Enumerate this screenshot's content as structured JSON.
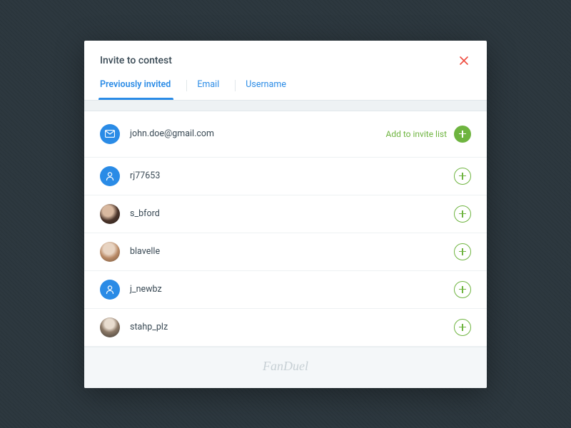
{
  "modal": {
    "title": "Invite to contest",
    "tabs": [
      "Previously invited",
      "Email",
      "Username"
    ],
    "activeTab": 0,
    "addLabel": "Add to invite list",
    "brand": "FanDuel"
  },
  "list": [
    {
      "name": "john.doe@gmail.com",
      "avatarType": "email",
      "showAddLabel": true,
      "filled": true
    },
    {
      "name": "rj77653",
      "avatarType": "user",
      "showAddLabel": false,
      "filled": false
    },
    {
      "name": "s_bford",
      "avatarType": "photo1",
      "showAddLabel": false,
      "filled": false
    },
    {
      "name": "blavelle",
      "avatarType": "photo2",
      "showAddLabel": false,
      "filled": false
    },
    {
      "name": "j_newbz",
      "avatarType": "user",
      "showAddLabel": false,
      "filled": false
    },
    {
      "name": "stahp_plz",
      "avatarType": "photo3",
      "showAddLabel": false,
      "filled": false
    }
  ]
}
